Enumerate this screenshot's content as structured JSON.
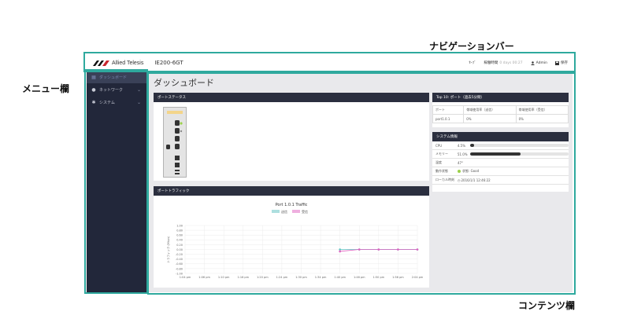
{
  "callouts": {
    "navbar": "ナビゲーションバー",
    "menu": "メニュー欄",
    "content": "コンテンツ欄"
  },
  "navbar": {
    "logo_text": "Allied Telesis",
    "model": "IE200-6GT",
    "save_label": "ｾｰﾌﾞ",
    "uptime_label": "稼働時間",
    "uptime_value": "0 days 00:27",
    "user": "Admin",
    "action_label": "保存",
    "user_icon": "user-icon",
    "save_icon": "floppy-icon"
  },
  "sidebar": {
    "items": [
      {
        "label": "ダッシュボード",
        "icon": "dashboard-icon",
        "active": true
      },
      {
        "label": "ネットワーク",
        "icon": "globe-icon",
        "active": false
      },
      {
        "label": "システム",
        "icon": "gear-icon",
        "active": false
      }
    ]
  },
  "content": {
    "title": "ダッシュボード",
    "port_status": {
      "title": "ポートステータス"
    },
    "port_traffic": {
      "title": "ポートトラフィック"
    },
    "top10": {
      "title": "Top 10: ポート（過去5分間）",
      "headers": [
        "ポート",
        "帯域使用率（送信）",
        "帯域使用率（受信）"
      ],
      "rows": [
        [
          "port1.0.1",
          "0%",
          "0%"
        ]
      ]
    },
    "resources": {
      "title": "システム情報",
      "cpu_label": "CPU",
      "cpu_value": "4.5%",
      "cpu_level": 0.045,
      "mem_label": "メモリー",
      "mem_value": "51.0%",
      "mem_level": 0.51,
      "temp_label": "温度",
      "temp_value": "47°",
      "fan_label": "動作状態",
      "fan_value": "状態: Good",
      "time_label": "ローカル時刻",
      "time_value": "2016/1/1 12:46:22"
    }
  },
  "chart_data": {
    "type": "line",
    "title": "Port 1.0.1 Traffic",
    "legend": [
      "送信",
      "受信"
    ],
    "ylabel": "トラフィック (Mbps)",
    "categories": [
      "1:04 pm",
      "1:06 pm",
      "1:10 pm",
      "1:16 pm",
      "1:20 pm",
      "1:24 pm",
      "1:30 pm",
      "1:34 pm",
      "1:40 pm",
      "1:46 pm",
      "1:50 pm",
      "1:56 pm",
      "2:04 pm"
    ],
    "y_ticks": [
      "1.00",
      "0.80",
      "0.60",
      "0.40",
      "0.20",
      "0.00",
      "-0.20",
      "-0.40",
      "-0.60",
      "-0.80",
      "-1.00"
    ],
    "ylim": [
      -1,
      1
    ],
    "series": [
      {
        "name": "送信",
        "color": "#5cc0c0",
        "points": [
          [
            8,
            0.0
          ],
          [
            9,
            0.0
          ],
          [
            10,
            0.0
          ],
          [
            11,
            0.0
          ],
          [
            12,
            0.0
          ]
        ]
      },
      {
        "name": "受信",
        "color": "#e060c0",
        "points": [
          [
            8,
            -0.08
          ],
          [
            9,
            0.0
          ],
          [
            10,
            0.0
          ],
          [
            11,
            0.0
          ],
          [
            12,
            0.0
          ]
        ]
      }
    ]
  }
}
